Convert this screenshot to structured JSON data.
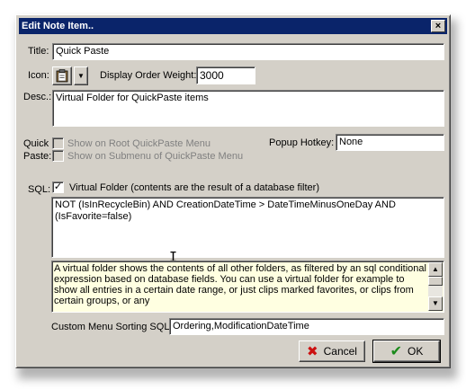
{
  "window": {
    "title": "Edit Note Item..",
    "close_glyph": "×"
  },
  "form": {
    "title_label": "Title:",
    "title_value": "Quick Paste",
    "icon_label": "Icon:",
    "icon_name": "clipboard-icon",
    "dropdown_glyph": "▼",
    "display_order_label": "Display Order Weight:",
    "display_order_value": "3000",
    "desc_label": "Desc.:",
    "desc_value": "Virtual Folder for QuickPaste items",
    "quickpaste_label_1": "Quick",
    "quickpaste_label_2": "Paste:",
    "show_root_label": "Show on Root QuickPaste Menu",
    "show_submenu_label": "Show on Submenu of QuickPaste Menu",
    "popup_hotkey_label": "Popup Hotkey:",
    "popup_hotkey_value": "None",
    "sql_label": "SQL:",
    "sql_check_glyph": "✓",
    "virtual_folder_label": "Virtual Folder (contents are the result of a database filter)",
    "sql_value": "NOT (IsInRecycleBin) AND CreationDateTime > DateTimeMinusOneDay AND (IsFavorite=false)",
    "info_text": "A virtual folder shows the contents of all other folders, as filtered by an sql conditional expression based on database fields.  You can use a virtual folder for example to show all entries in a certain date range, or just clips marked favorites, or clips from certain groups, or any",
    "custom_sort_label": "Custom Menu Sorting SQL:",
    "custom_sort_value": "Ordering,ModificationDateTime",
    "cursor_glyph": "I"
  },
  "buttons": {
    "cancel_label": "Cancel",
    "cancel_glyph": "✖",
    "ok_label": "OK",
    "ok_glyph": "✔",
    "scroll_up": "▲",
    "scroll_down": "▼"
  },
  "colors": {
    "titlebar": "#0a246a",
    "info_bg": "#ffffe1",
    "cancel_icon": "#cc1111",
    "ok_icon": "#1a8a1a"
  }
}
